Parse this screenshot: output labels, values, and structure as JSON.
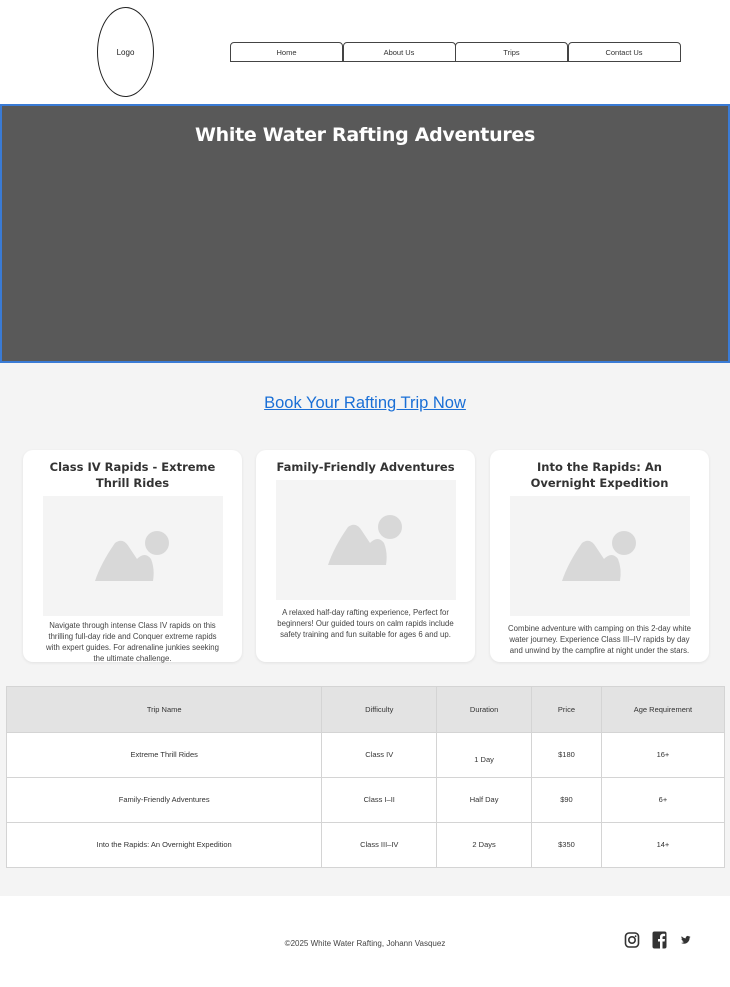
{
  "header": {
    "logo_label": "Logo",
    "nav": [
      {
        "label": "Home"
      },
      {
        "label": "About Us"
      },
      {
        "label": "Trips"
      },
      {
        "label": "Contact Us"
      }
    ]
  },
  "hero": {
    "title": "White Water Rafting Adventures"
  },
  "cta": {
    "label": "Book Your Rafting Trip Now"
  },
  "cards": [
    {
      "title": "Class IV Rapids - Extreme Thrill Rides",
      "text": "Navigate through intense Class IV rapids on this thrilling full-day ride and Conquer extreme rapids with expert guides. For adrenaline junkies seeking the ultimate challenge."
    },
    {
      "title": "Family-Friendly Adventures",
      "text": "A relaxed half-day rafting experience, Perfect for beginners! Our guided tours on calm rapids include safety training and fun suitable for ages 6 and up."
    },
    {
      "title": "Into the Rapids: An Overnight Expedition",
      "text": "Combine adventure with camping on this 2-day white water journey. Experience Class III–IV rapids by day and unwind by the campfire at night under the stars."
    }
  ],
  "table": {
    "headers": [
      "Trip Name",
      "Difficulty",
      "Duration",
      "Price",
      "Age Requirement"
    ],
    "rows": [
      [
        "Extreme Thrill Rides",
        "Class IV",
        "1 Day",
        "$180",
        "16+"
      ],
      [
        "Family-Friendly Adventures",
        "Class I–II",
        "Half Day",
        "$90",
        "6+"
      ],
      [
        "Into the Rapids: An Overnight Expedition",
        "Class III–IV",
        "2 Days",
        "$350",
        "14+"
      ]
    ]
  },
  "footer": {
    "copyright": "©2025 White Water Rafting, Johann Vasquez",
    "socials": [
      {
        "icon": "instagram-icon"
      },
      {
        "icon": "facebook-icon"
      },
      {
        "icon": "twitter-icon"
      }
    ]
  },
  "colors": {
    "hero_bg": "#595959",
    "hero_border": "#3a7bd5",
    "link": "#1a6fd6",
    "page_bg": "#f4f4f4"
  }
}
